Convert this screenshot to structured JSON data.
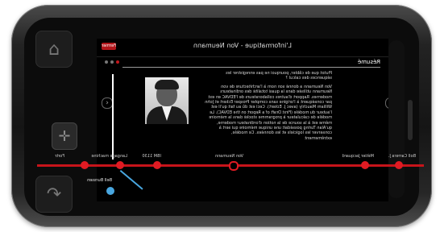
{
  "app": {
    "title": "L'informatique - Von Neumann",
    "close_label": "Fermer"
  },
  "section": {
    "label": "Résumé"
  },
  "pager": {
    "pages": 3,
    "active": 1
  },
  "nav": {
    "prev": "‹",
    "next": "›"
  },
  "article": {
    "question": "Plutot que de câbler, pourquoi ne pas enregistrer les séquences des calcul ?",
    "body": "Von Neumann a donné son nom à l'architecture de von Neumann utilisée dans la quasi totalité des ordinateurs modernes. Rapport d'autres collaborateurs de l'EDVAC en est par conséquent à l'origine sans compter Prosper Eckert et John William Mauchly (avec J. Eckert). Ceci est dû au fait qu'il est l'auteur du modèle (First Draft of a Report on the EDVAC). Le modèle de calculateur à programme stocké dans la mémoire même est à la source de la notion d'ordinateur moderne, qu'Alan Turing possédait une unique mémoire qui sert à conserver les logiciels et les données. Ce modèle, extrêmement"
  },
  "timeline": {
    "items": [
      {
        "label": "Boll Carrera J."
      },
      {
        "label": "Métier Jacquard"
      },
      {
        "label": "Von Neumann"
      },
      {
        "label": "IBM 1130"
      },
      {
        "label": "Langage machine"
      },
      {
        "label": "Fortr"
      }
    ],
    "current_label": "Bell Burssen"
  },
  "hardware": {
    "home_icon": "house-icon",
    "back_icon": "back-arrow-icon",
    "power_icon": "power-icon"
  },
  "colors": {
    "accent": "#c2161b",
    "highlight": "#49a7e0"
  }
}
